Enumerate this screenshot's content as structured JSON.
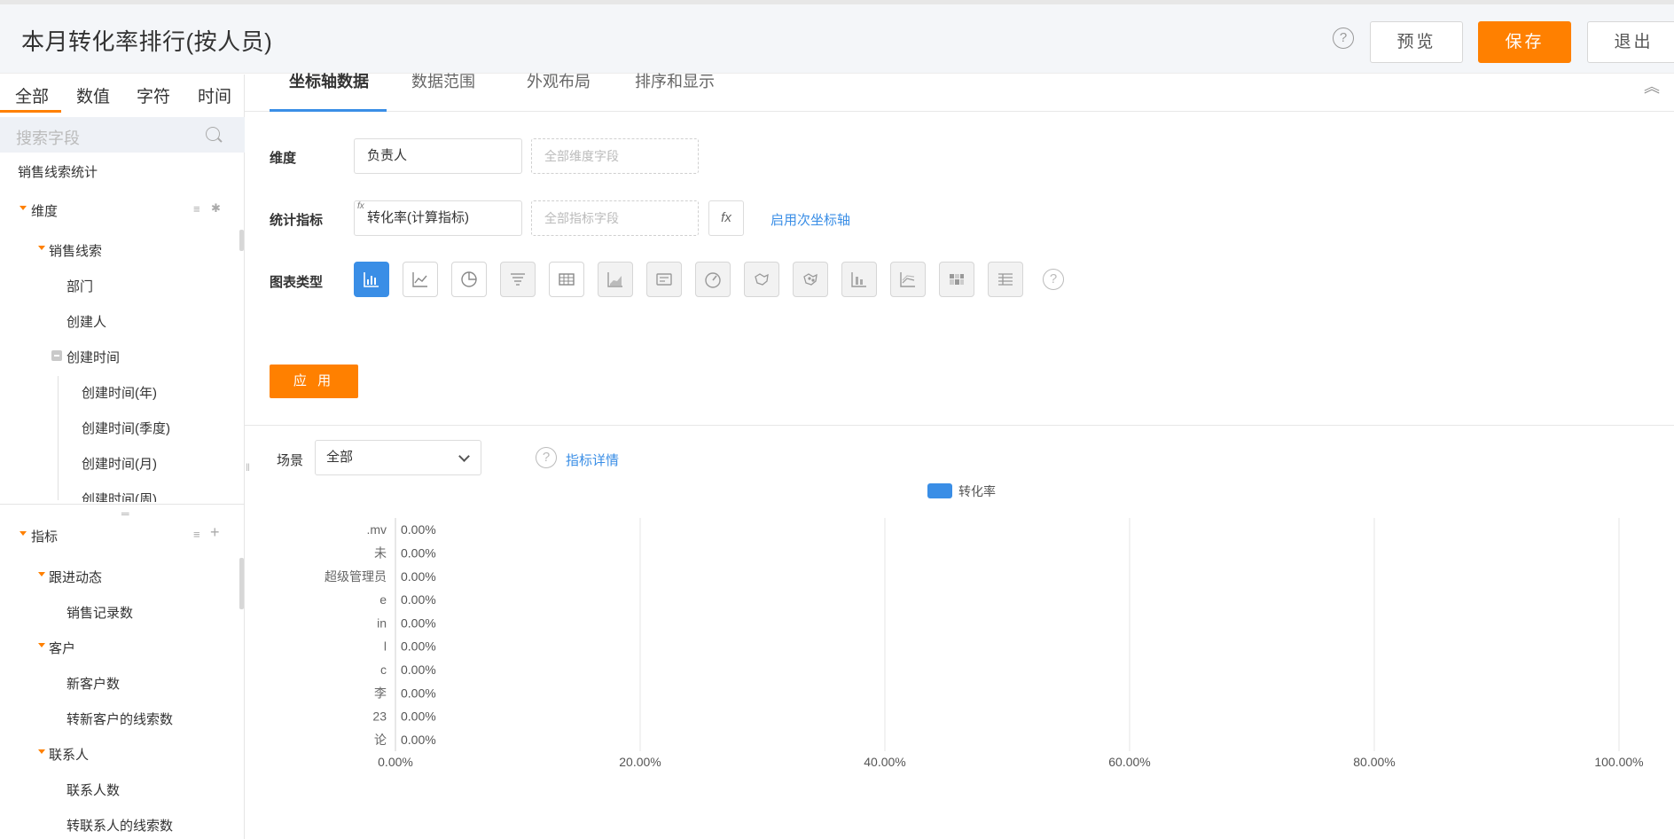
{
  "header": {
    "title": "本月转化率排行(按人员)",
    "help": "?",
    "preview_label": "预览",
    "save_label": "保存",
    "exit_label": "退出"
  },
  "sidebar": {
    "tabs": [
      "全部",
      "数值",
      "字符",
      "时间"
    ],
    "search_placeholder": "搜索字段",
    "source": "销售线索统计",
    "dimension_group": "维度",
    "dimension_sub": "销售线索",
    "dimension_items": [
      "部门",
      "创建人"
    ],
    "time_group": "创建时间",
    "time_items": [
      "创建时间(年)",
      "创建时间(季度)",
      "创建时间(月)",
      "创建时间(周)"
    ],
    "metric_group": "指标",
    "metric_sections": [
      {
        "name": "跟进动态",
        "items": [
          "销售记录数"
        ]
      },
      {
        "name": "客户",
        "items": [
          "新客户数",
          "转新客户的线索数"
        ]
      },
      {
        "name": "联系人",
        "items": [
          "联系人数",
          "转联系人的线索数"
        ]
      }
    ]
  },
  "tabs": [
    "坐标轴数据",
    "数据范围",
    "外观布局",
    "排序和显示"
  ],
  "form": {
    "dimension_label": "维度",
    "dimension_value": "负责人",
    "dimension_placeholder": "全部维度字段",
    "metric_label": "统计指标",
    "metric_value": "转化率(计算指标)",
    "metric_fx": "fx",
    "metric_placeholder": "全部指标字段",
    "fx_label": "fx",
    "secondary_axis_link": "启用次坐标轴",
    "chart_type_label": "图表类型",
    "chart_types": [
      "bar-horizontal",
      "line",
      "pie",
      "funnel",
      "table",
      "area",
      "card",
      "gauge",
      "map",
      "scatter",
      "stacked-bar",
      "multi-line",
      "heatmap",
      "pivot"
    ],
    "apply_label": "应 用"
  },
  "scene": {
    "label": "场景",
    "selected": "全部",
    "metric_detail_link": "指标详情"
  },
  "chart_data": {
    "type": "bar",
    "orientation": "horizontal",
    "legend": [
      "转化率"
    ],
    "categories": [
      ".mv",
      "未",
      "超级管理员",
      "e",
      "in",
      "l",
      "c",
      "李",
      "23",
      "论"
    ],
    "series": [
      {
        "name": "转化率",
        "values": [
          0,
          0,
          0,
          0,
          0,
          0,
          0,
          0,
          0,
          0
        ]
      }
    ],
    "data_labels": [
      "0.00%",
      "0.00%",
      "0.00%",
      "0.00%",
      "0.00%",
      "0.00%",
      "0.00%",
      "0.00%",
      "0.00%",
      "0.00%"
    ],
    "x_ticks": [
      "0.00%",
      "20.00%",
      "40.00%",
      "60.00%",
      "80.00%",
      "100.00%"
    ],
    "xlim": [
      0,
      100
    ],
    "grid": true,
    "legend_position": "top-center",
    "color": "#3a8ee6"
  }
}
